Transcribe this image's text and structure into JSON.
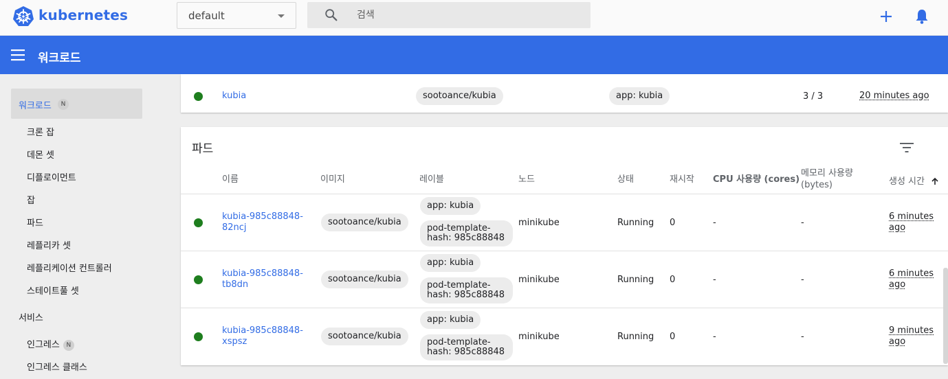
{
  "brand": {
    "name": "kubernetes",
    "color": "#326ce5"
  },
  "namespace": {
    "value": "default"
  },
  "search": {
    "placeholder": "검색"
  },
  "header": {
    "title": "워크로드"
  },
  "icons": {
    "menu": "menu-icon",
    "search": "search-icon",
    "add": "plus-icon",
    "notifications": "bell-icon",
    "filter": "filter-icon",
    "sort": "arrow-up-icon"
  },
  "sidebar": {
    "active": {
      "label": "워크로드",
      "badge": "N"
    },
    "items": [
      {
        "label": "크론 잡"
      },
      {
        "label": "데몬 셋"
      },
      {
        "label": "디플로이먼트"
      },
      {
        "label": "잡"
      },
      {
        "label": "파드"
      },
      {
        "label": "레플리카 셋"
      },
      {
        "label": "레플리케이션 컨트롤러"
      },
      {
        "label": "스테이트풀 셋"
      }
    ],
    "group": {
      "label": "서비스"
    },
    "service_items": [
      {
        "label": "인그레스",
        "badge": "N"
      },
      {
        "label": "인그레스 클래스"
      }
    ]
  },
  "deployment_row": {
    "name": "kubia",
    "image": "sootoance/kubia",
    "label": "app: kubia",
    "pods": "3 / 3",
    "created": "20 minutes ago"
  },
  "pods": {
    "title": "파드",
    "columns": [
      "이름",
      "이미지",
      "레이블",
      "노드",
      "상태",
      "재시작",
      "CPU 사용량 (cores)",
      "메모리 사용량 (bytes)",
      "생성 시간"
    ],
    "rows": [
      {
        "name": "kubia-985c88848-82ncj",
        "image": "sootoance/kubia",
        "label1": "app: kubia",
        "label2": "pod-template-hash: 985c88848",
        "node": "minikube",
        "status": "Running",
        "restarts": "0",
        "cpu": "-",
        "memory": "-",
        "created": "6 minutes ago"
      },
      {
        "name": "kubia-985c88848-tb8dn",
        "image": "sootoance/kubia",
        "label1": "app: kubia",
        "label2": "pod-template-hash: 985c88848",
        "node": "minikube",
        "status": "Running",
        "restarts": "0",
        "cpu": "-",
        "memory": "-",
        "created": "6 minutes ago"
      },
      {
        "name": "kubia-985c88848-xspsz",
        "image": "sootoance/kubia",
        "label1": "app: kubia",
        "label2": "pod-template-hash: 985c88848",
        "node": "minikube",
        "status": "Running",
        "restarts": "0",
        "cpu": "-",
        "memory": "-",
        "created": "9 minutes ago"
      }
    ]
  },
  "colors": {
    "header": "#326ce5",
    "running": "#1e7e1e"
  }
}
